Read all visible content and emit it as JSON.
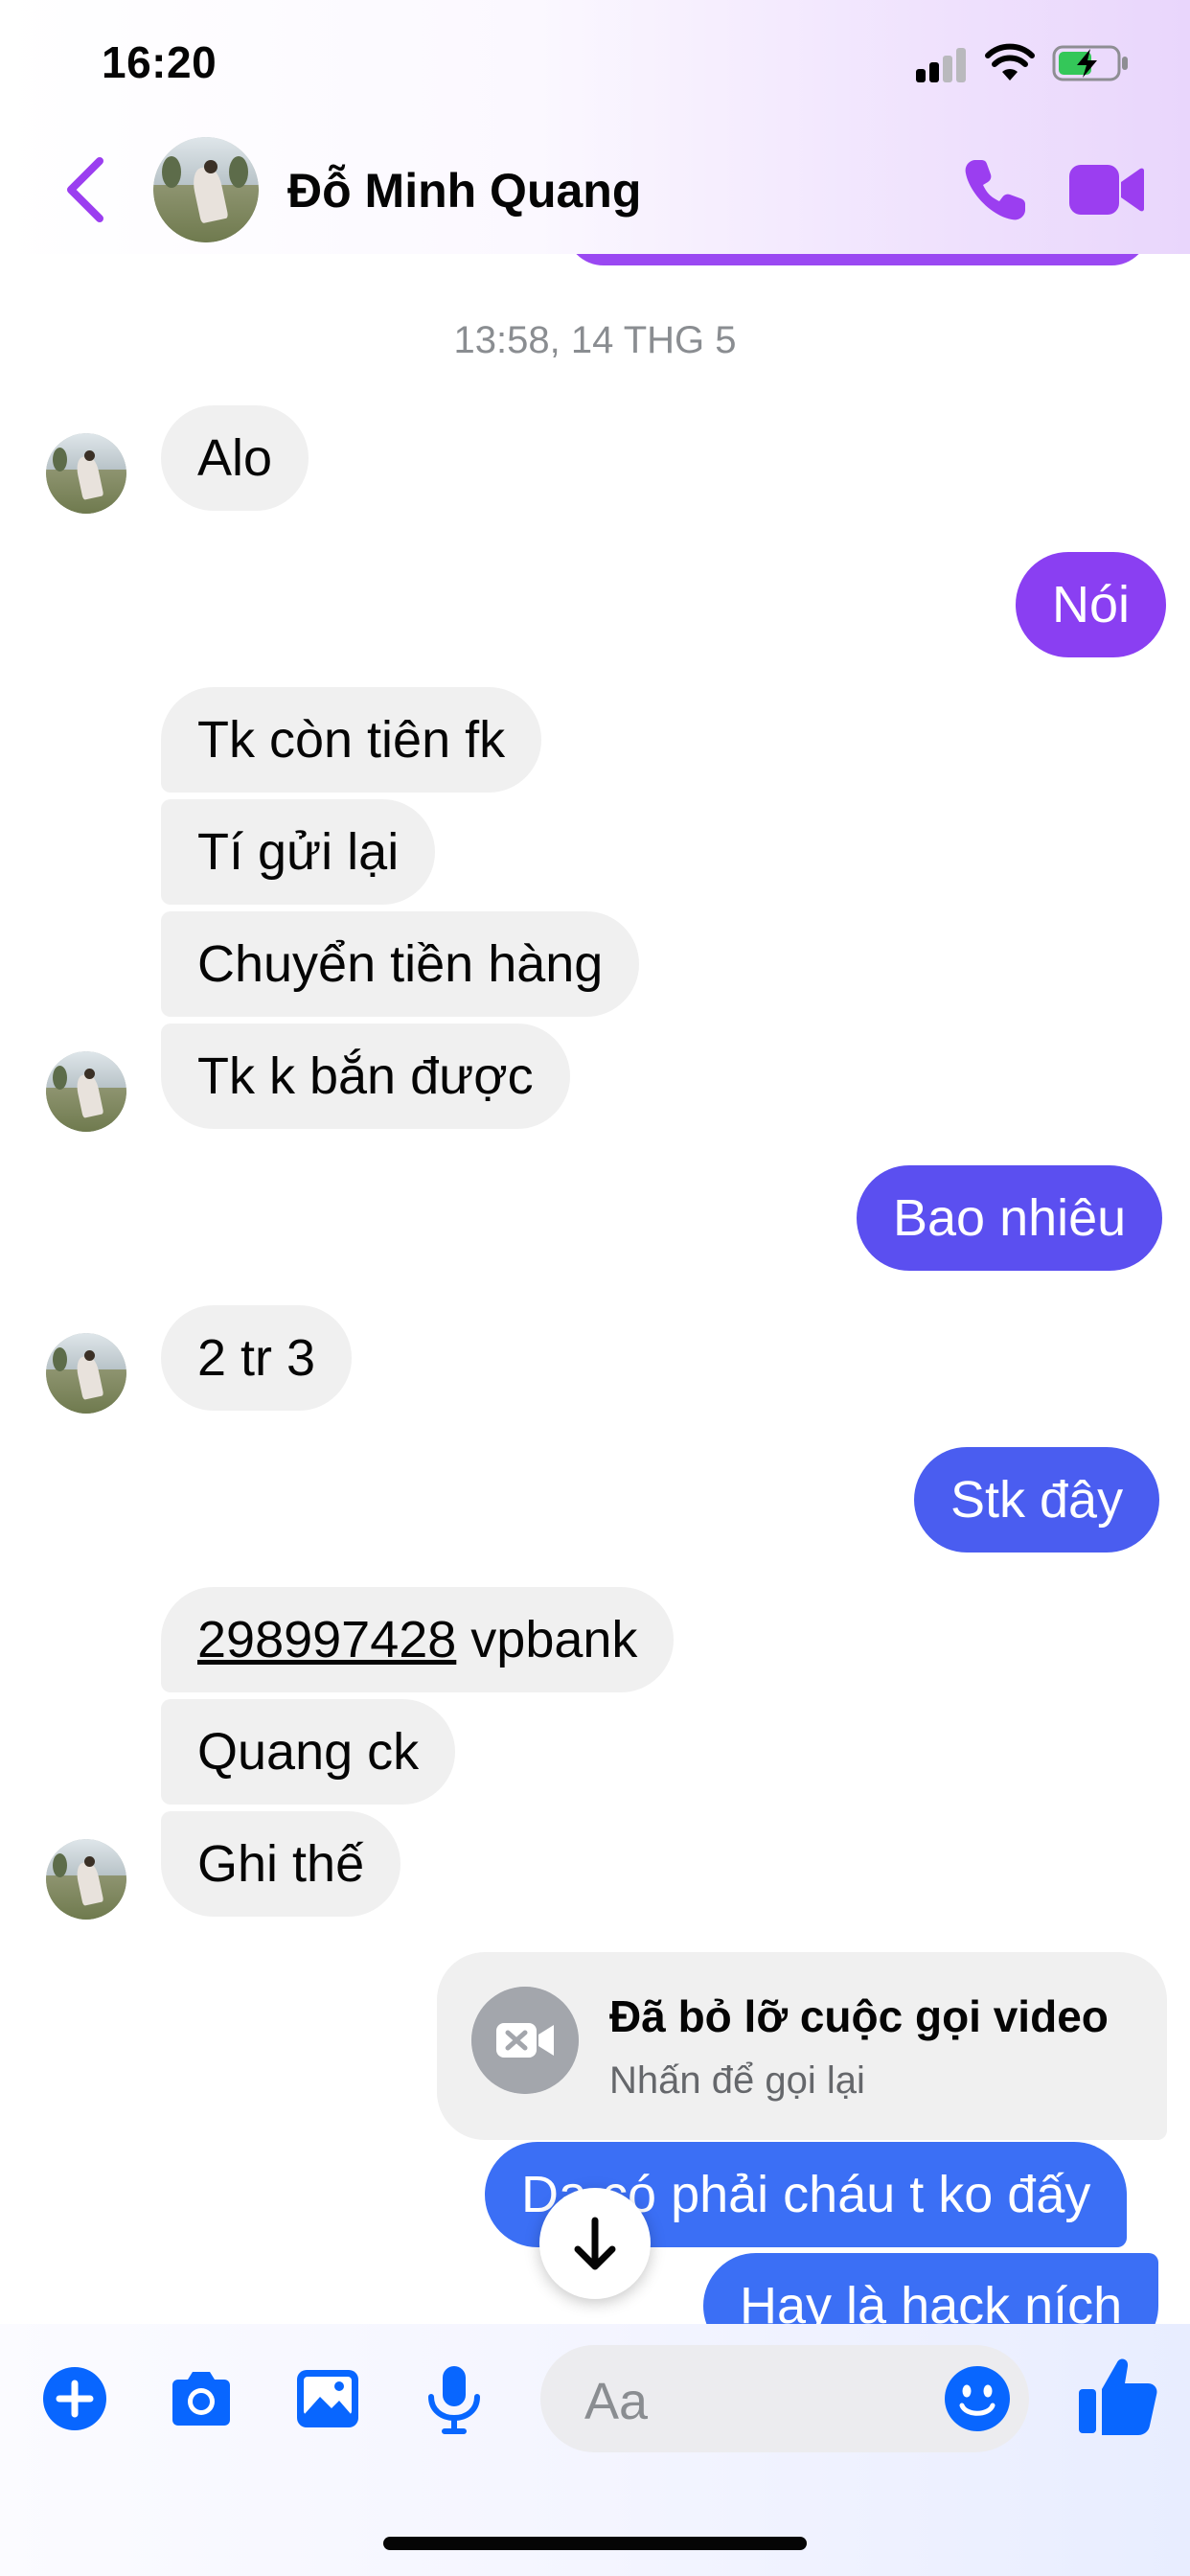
{
  "status_bar": {
    "time": "16:20"
  },
  "header": {
    "contact_name": "Đỗ Minh Quang",
    "icons": [
      "chevron-left-icon",
      "phone-icon",
      "video-camera-icon"
    ],
    "accent_color": "#9b3ef0"
  },
  "thread": {
    "timestamp": "13:58, 14 THG 5",
    "messages": [
      {
        "from": "them",
        "text": "Alo"
      },
      {
        "from": "me",
        "text": "Nói"
      },
      {
        "from": "them",
        "text": "Tk còn tiên fk"
      },
      {
        "from": "them",
        "text": "Tí gửi lại"
      },
      {
        "from": "them",
        "text": "Chuyển tiền hàng"
      },
      {
        "from": "them",
        "text": "Tk k bắn được"
      },
      {
        "from": "me",
        "text": "Bao nhiêu"
      },
      {
        "from": "them",
        "text": "2 tr 3"
      },
      {
        "from": "me",
        "text": "Stk đây"
      },
      {
        "from": "them",
        "account_number": "298997428",
        "text": " vpbank"
      },
      {
        "from": "them",
        "text": "Quang ck"
      },
      {
        "from": "them",
        "text": "Ghi thế"
      },
      {
        "from": "me",
        "text": "Dạ có phải cháu t ko đấy"
      },
      {
        "from": "me",
        "text": "Hay là hack ních"
      }
    ],
    "missed_call": {
      "title": "Đã bỏ lỡ cuộc gọi video",
      "subtitle": "Nhấn để gọi lại"
    }
  },
  "composer": {
    "placeholder": "Aa",
    "tools": [
      "plus-icon",
      "camera-icon",
      "image-icon",
      "microphone-icon"
    ],
    "accent_color": "#0866ff"
  },
  "colors": {
    "bubble_incoming": "#f0f0f0",
    "bubble_outgoing_purple": "#8a3ff2",
    "bubble_outgoing_blue": "#4a5df0",
    "bubble_outgoing_bottom": "#3b6ff5"
  }
}
